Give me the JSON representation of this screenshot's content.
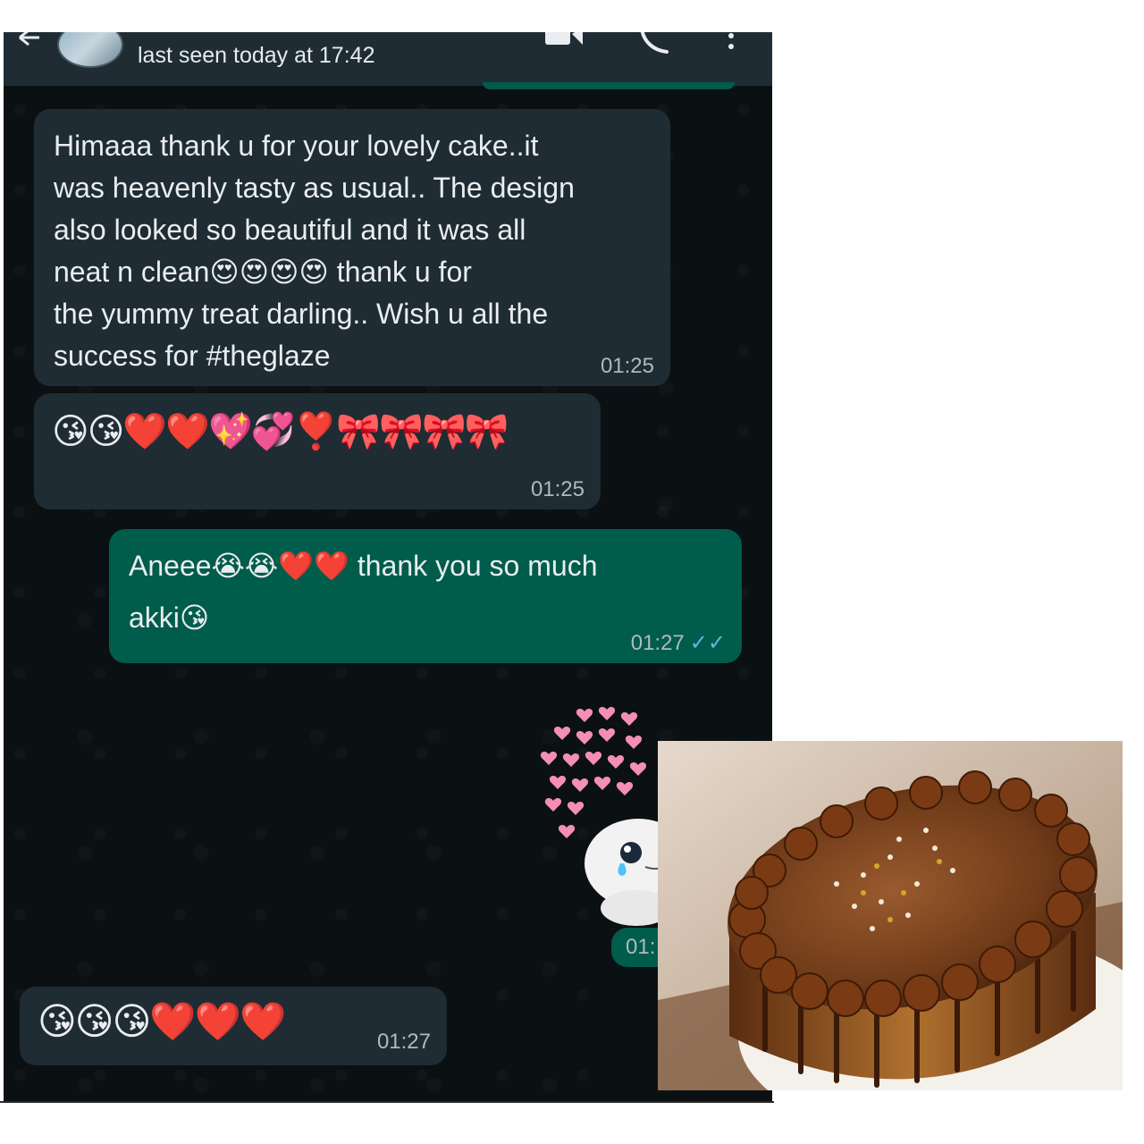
{
  "header": {
    "status": "last seen today at 17:42"
  },
  "messages": [
    {
      "direction": "in",
      "text": "Himaaa thank u for your lovely cake..it\nwas heavenly tasty as usual.. The design\nalso looked so beautiful and it was all\nneat n clean😍😍😍😍 thank u for\nthe yummy treat darling.. Wish u all the\nsuccess for #theglaze",
      "time": "01:25"
    },
    {
      "direction": "in",
      "text": "😘😘❤️❤️💖💞❣️🎀🎀🎀🎀",
      "time": "01:25"
    },
    {
      "direction": "out",
      "text": "Aneee😭😭❤️❤️ thank you so much\nakki😘",
      "time": "01:27",
      "status": "read"
    },
    {
      "direction": "out",
      "type": "sticker",
      "sticker": "crying-blob-with-hearts",
      "time_partial": "01:"
    },
    {
      "direction": "in",
      "text": "😘😘😘❤️❤️❤️",
      "time": "01:27"
    }
  ],
  "icons": {
    "back": "arrow-left-icon",
    "video": "video-camera-icon",
    "call": "phone-icon",
    "menu": "more-vert-icon",
    "read_receipt": "double-check-icon"
  },
  "photo": {
    "subject": "chocolate-cake",
    "read_receipt_glyph": "✓✓"
  },
  "colors": {
    "header_bg": "#1f2c33",
    "chat_bg": "#0b1013",
    "incoming_bubble": "#1f2c33",
    "outgoing_bubble": "#005c4b",
    "text": "#e9edef",
    "timestamp": "#aebac1",
    "read_tick": "#53bdeb"
  }
}
